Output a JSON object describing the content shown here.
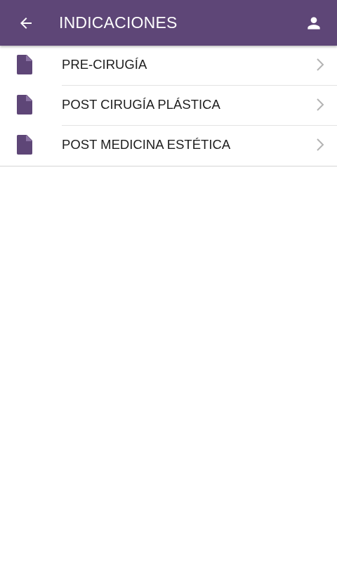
{
  "toolbar": {
    "title": "INDICACIONES",
    "back_icon": "arrow-left-icon",
    "profile_icon": "person-icon",
    "background_color": "#5e4677"
  },
  "list": {
    "icon_color": "#5e4677",
    "items": [
      {
        "label": "PRE-CIRUGÍA",
        "icon": "document-icon"
      },
      {
        "label": "POST CIRUGÍA PLÁSTICA",
        "icon": "document-icon"
      },
      {
        "label": "POST MEDICINA ESTÉTICA",
        "icon": "document-icon"
      }
    ]
  }
}
